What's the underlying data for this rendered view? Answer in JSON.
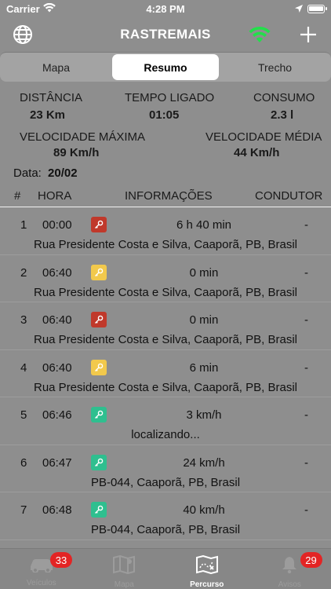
{
  "status_bar": {
    "carrier": "Carrier",
    "time": "4:28 PM"
  },
  "nav": {
    "title": "RASTREMAIS"
  },
  "segments": [
    {
      "label": "Mapa",
      "active": false
    },
    {
      "label": "Resumo",
      "active": true
    },
    {
      "label": "Trecho",
      "active": false
    }
  ],
  "summary": {
    "distance_label": "DISTÂNCIA",
    "distance_value": "23 Km",
    "time_on_label": "TEMPO LIGADO",
    "time_on_value": "01:05",
    "consumption_label": "CONSUMO",
    "consumption_value": "2.3 l",
    "max_speed_label": "VELOCIDADE MÁXIMA",
    "max_speed_value": "89 Km/h",
    "avg_speed_label": "VELOCIDADE MÉDIA",
    "avg_speed_value": "44 Km/h",
    "date_label": "Data:",
    "date_value": "20/02"
  },
  "columns": {
    "num": "#",
    "time": "HORA",
    "info": "INFORMAÇÕES",
    "driver": "CONDUTOR"
  },
  "colors": {
    "ignition_off": "#c0392b",
    "idle": "#f2c94c",
    "moving": "#2fbf8f",
    "badge": "#e32424"
  },
  "rows": [
    {
      "num": "1",
      "time": "00:00",
      "event_icon": "key-red",
      "info": "6 h 40 min",
      "driver": "-",
      "address": "Rua Presidente Costa e Silva, Caaporã, PB, Brasil"
    },
    {
      "num": "2",
      "time": "06:40",
      "event_icon": "key-yellow",
      "info": "0 min",
      "driver": "-",
      "address": "Rua Presidente Costa e Silva, Caaporã, PB, Brasil"
    },
    {
      "num": "3",
      "time": "06:40",
      "event_icon": "key-red",
      "info": "0 min",
      "driver": "-",
      "address": "Rua Presidente Costa e Silva, Caaporã, PB, Brasil"
    },
    {
      "num": "4",
      "time": "06:40",
      "event_icon": "key-yellow",
      "info": "6 min",
      "driver": "-",
      "address": "Rua Presidente Costa e Silva, Caaporã, PB, Brasil"
    },
    {
      "num": "5",
      "time": "06:46",
      "event_icon": "key-green",
      "info": "3 km/h",
      "driver": "-",
      "address": "localizando..."
    },
    {
      "num": "6",
      "time": "06:47",
      "event_icon": "key-green",
      "info": "24 km/h",
      "driver": "-",
      "address": "PB-044, Caaporã, PB, Brasil"
    },
    {
      "num": "7",
      "time": "06:48",
      "event_icon": "key-green",
      "info": "40 km/h",
      "driver": "-",
      "address": "PB-044, Caaporã, PB, Brasil"
    }
  ],
  "tabs": [
    {
      "label": "Veículos",
      "badge": "33",
      "icon": "car-icon",
      "active": false
    },
    {
      "label": "Mapa",
      "badge": "",
      "icon": "map-icon",
      "active": false
    },
    {
      "label": "Percurso",
      "badge": "",
      "icon": "route-map-icon",
      "active": true
    },
    {
      "label": "Avisos",
      "badge": "29",
      "icon": "bell-icon",
      "active": false
    }
  ]
}
